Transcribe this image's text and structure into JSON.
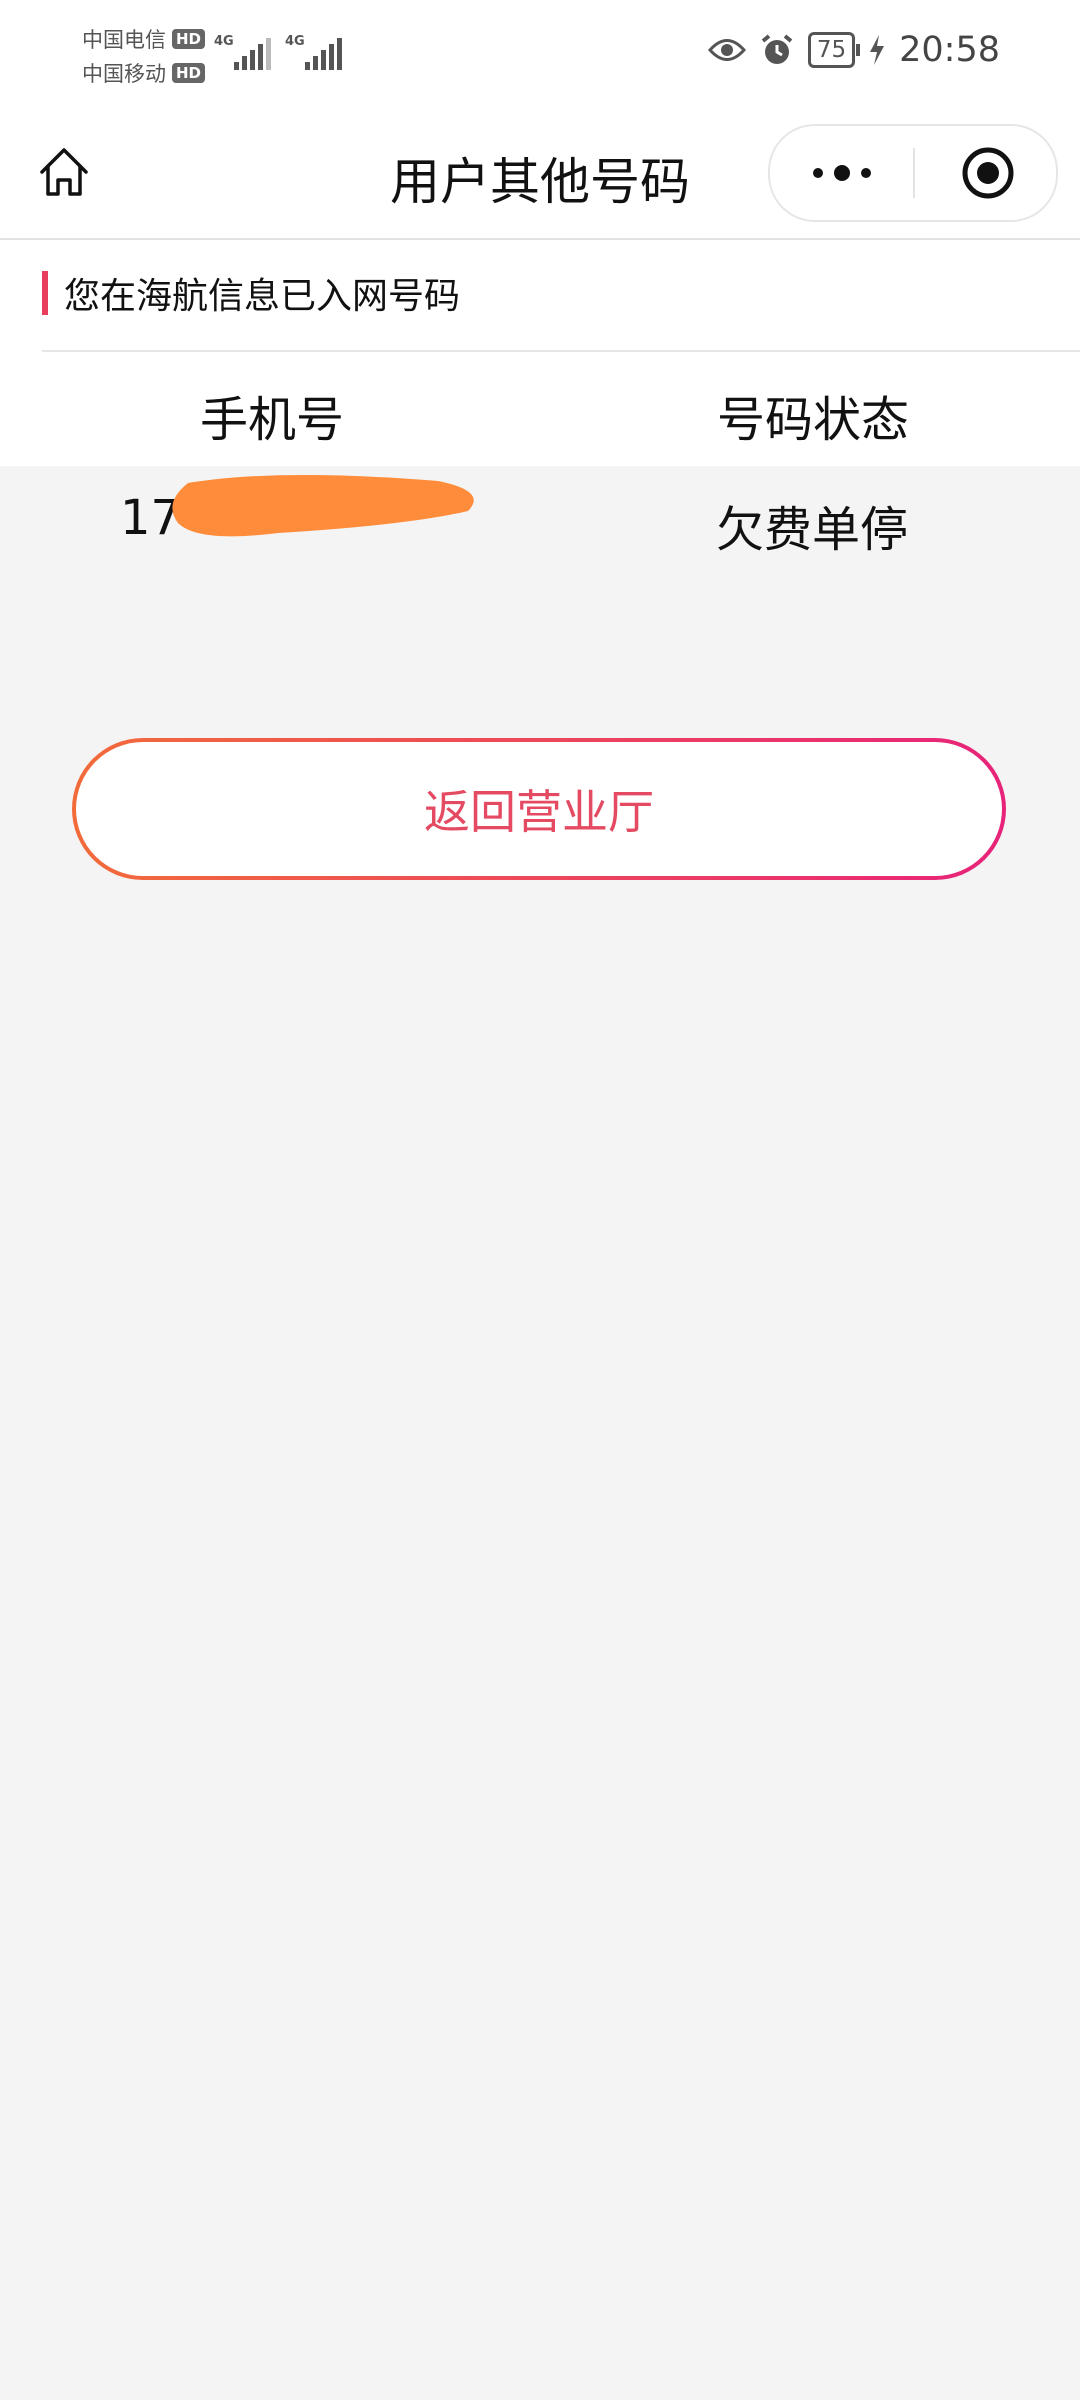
{
  "status_bar": {
    "carrier1": "中国电信",
    "carrier2": "中国移动",
    "hd1": "HD",
    "hd2": "HD",
    "net1": "4G",
    "net2": "4G",
    "battery": "75",
    "time": "20:58"
  },
  "nav": {
    "title": "用户其他号码",
    "home_icon": "home-icon",
    "more_icon": "more-dots-icon",
    "close_icon": "target-icon"
  },
  "section": {
    "title": "您在海航信息已入网号码",
    "accent": "#e63e5c",
    "headers": [
      "手机号",
      "号码状态"
    ],
    "rows": [
      {
        "phone_prefix": "17",
        "status": "欠费单停"
      }
    ]
  },
  "back_button": {
    "label": "返回营业厅",
    "gradient": [
      "#f26b3a",
      "#e8237a"
    ],
    "text_color": "#e54a63"
  },
  "redaction_color": "#ff8c3a"
}
